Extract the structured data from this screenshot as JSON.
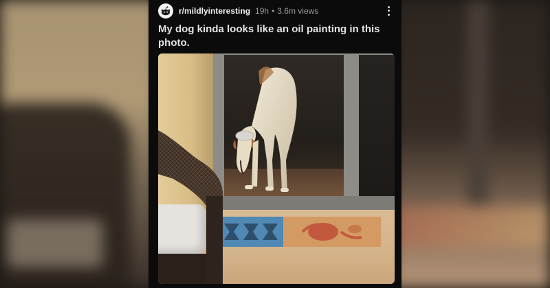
{
  "post": {
    "subreddit": "r/mildlyinteresting",
    "time_ago": "19h",
    "separator": "•",
    "views": "3.6m views",
    "title": "My dog kinda looks like an oil painting in this photo."
  },
  "icons": {
    "avatar": "reddit-alien-icon",
    "more": "more-vertical-icon"
  },
  "colors": {
    "card_background": "#0b0b0c",
    "title_text": "#e4e4e4",
    "meta_text": "#9a9a9a"
  }
}
